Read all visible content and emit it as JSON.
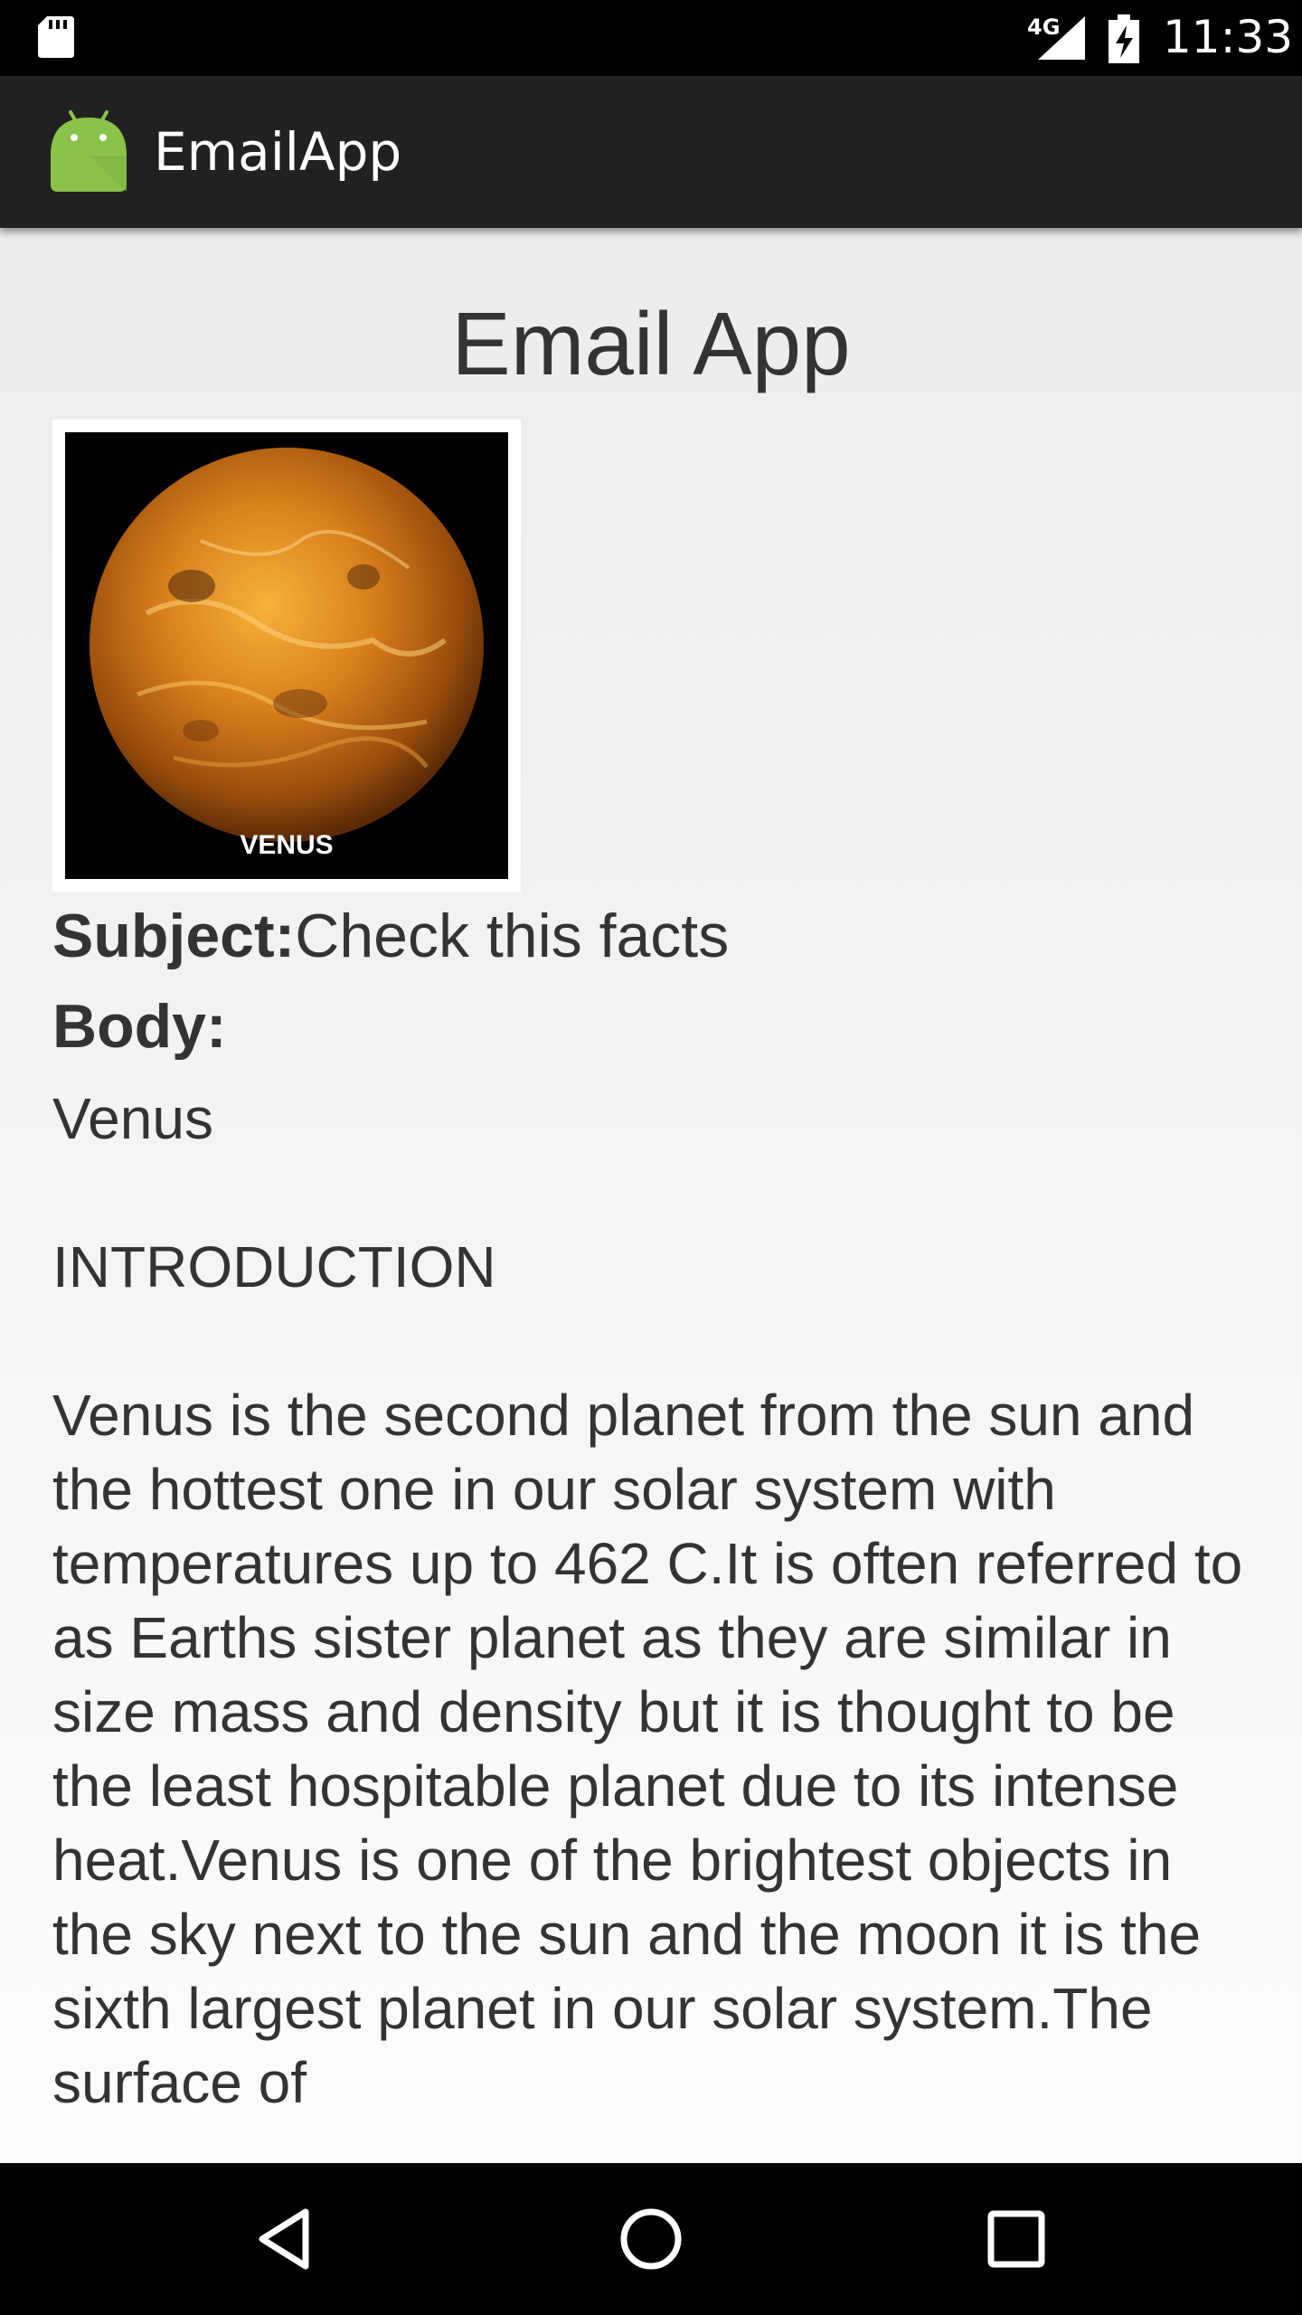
{
  "status_bar": {
    "network": "4G",
    "time": "11:33",
    "icons": [
      "sd-card-icon",
      "signal-icon",
      "battery-charging-icon"
    ]
  },
  "app_bar": {
    "title": "EmailApp",
    "logo_icon": "android-logo-icon"
  },
  "main": {
    "heading": "Email App",
    "image_caption": "VENUS",
    "subject_label": "Subject:",
    "subject_value": "Check this facts",
    "body_label": "Body:",
    "body_text": "Venus\n\nINTRODUCTION\n\nVenus is the second planet from the sun and the hottest one in our solar system with temperatures up to 462 C.It is often referred to as Earths sister planet as they are similar in size mass and density but it is thought to be the least hospitable planet due to its intense heat.Venus is one of the brightest objects in the sky next to the sun and the moon it is the sixth largest planet in our solar system.The surface of"
  },
  "nav_bar": {
    "icons": [
      "back-icon",
      "home-icon",
      "recents-icon"
    ]
  },
  "colors": {
    "status_bar": "#000000",
    "app_bar": "#212121",
    "android_green": "#8BC34A",
    "text": "#333333"
  }
}
